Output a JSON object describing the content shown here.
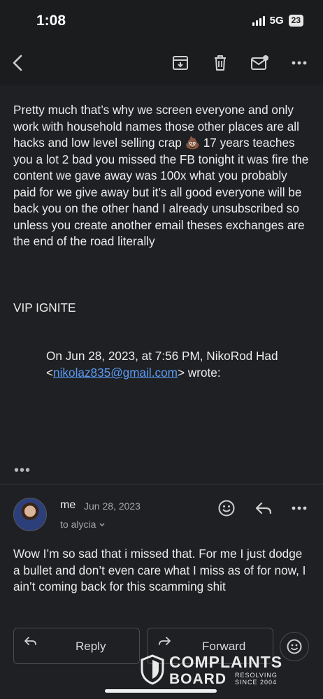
{
  "status_bar": {
    "time": "1:08",
    "network": "5G",
    "battery": "23"
  },
  "toolbar": {
    "icons": [
      "back-arrow-icon",
      "archive-icon",
      "trash-icon",
      "mark-unread-icon",
      "more-icon"
    ]
  },
  "message": {
    "body": "Pretty much that’s why we screen everyone and only work with household names those other places are all hacks and low level selling crap 💩 17 years teaches you a lot 2 bad you missed the FB tonight it was fire the content we gave away was 100x what you probably paid for we give away but it’s all good everyone will be back you on the other hand I already unsubscribed so unless you create another email theses exchanges are the end of the road literally",
    "signature": "VIP IGNITE",
    "quote_header": "On Jun 28, 2023, at 7:56 PM, NikoRod Had",
    "quote_email_open": "<",
    "quote_email": "nikolaz835@gmail.com",
    "quote_email_close": "> wrote:",
    "collapsed_indicator": "•••"
  },
  "reply": {
    "sender": "me",
    "date": "Jun 28, 2023",
    "to": "to alycia",
    "body": "Wow I’m so sad that i missed that. For me I just dodge a bullet and don’t even care what I miss as of for now, I ain’t coming back for this scamming shit"
  },
  "actions": {
    "reply_label": "Reply",
    "forward_label": "Forward"
  },
  "watermark": {
    "title": "COMPLAINTS",
    "subtitle": "BOARD",
    "tag_line1": "RESOLVING",
    "tag_line2": "SINCE 2004"
  }
}
